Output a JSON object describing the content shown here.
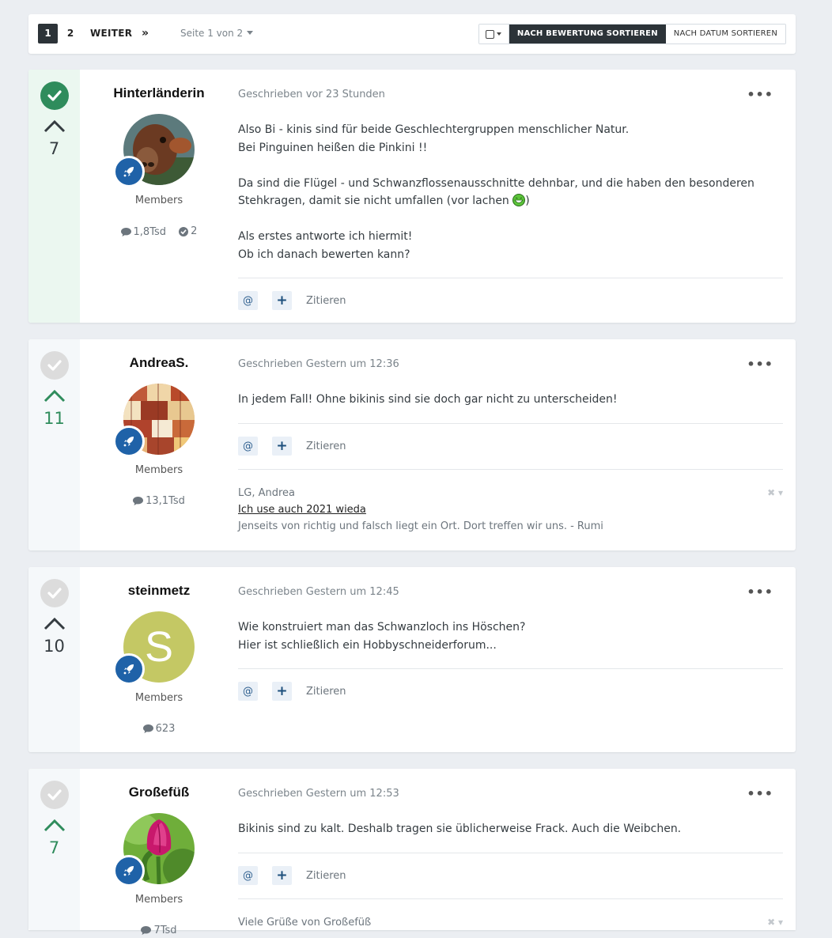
{
  "pagination": {
    "current": "1",
    "page2": "2",
    "next": "WEITER",
    "last_icon": "»",
    "info": "Seite 1 von 2"
  },
  "sort": {
    "by_rating": "NACH BEWERTUNG SORTIEREN",
    "by_date": "NACH DATUM SORTIEREN"
  },
  "colors": {
    "accent_green": "#2f8c5c",
    "rank_blue": "#1f62a8",
    "dark": "#2c3338"
  },
  "posts": [
    {
      "author": "Hinterländerin",
      "group": "Members",
      "posts_count": "1,8Tsd",
      "solutions_count": "2",
      "votes": "7",
      "solved": true,
      "meta": "Geschrieben vor 23 Stunden",
      "more": "•••",
      "lines": [
        "Also Bi - kinis sind für beide Geschlechtergruppen menschlicher Natur.",
        "Bei Pinguinen heißen die Pinkini !!",
        "",
        "Da sind die Flügel - und Schwanzflossenausschnitte dehnbar, und die haben den besonderen",
        "Stehkragen, damit sie nicht umfallen (vor lachen",
        "",
        "Als erstes antworte ich hiermit!",
        "Ob ich danach bewerten kann?"
      ],
      "line5_suffix": ")",
      "mention": "@",
      "plus": "+",
      "quote": "Zitieren"
    },
    {
      "author": "AndreaS.",
      "group": "Members",
      "posts_count": "13,1Tsd",
      "votes": "11",
      "meta": "Geschrieben Gestern um 12:36",
      "more": "•••",
      "lines": [
        "In jedem Fall! Ohne bikinis sind sie doch gar nicht zu unterscheiden!"
      ],
      "mention": "@",
      "plus": "+",
      "quote": "Zitieren",
      "signature": {
        "line1": "LG, Andrea",
        "link": "Ich use auch 2021 wieda",
        "line3": "Jenseits von richtig und falsch liegt ein Ort. Dort treffen wir uns. - Rumi"
      }
    },
    {
      "author": "steinmetz",
      "group": "Members",
      "posts_count": "623",
      "votes": "10",
      "avatar_letter": "S",
      "meta": "Geschrieben Gestern um 12:45",
      "more": "•••",
      "lines": [
        "Wie konstruiert man das Schwanzloch ins Höschen?",
        "Hier ist schließlich ein Hobbyschneiderforum..."
      ],
      "mention": "@",
      "plus": "+",
      "quote": "Zitieren"
    },
    {
      "author": "Großefüß",
      "group": "Members",
      "posts_count": "7Tsd",
      "votes": "7",
      "meta": "Geschrieben Gestern um 12:53",
      "more": "•••",
      "lines": [
        "Bikinis sind zu kalt. Deshalb tragen sie üblicherweise Frack. Auch die Weibchen."
      ],
      "mention": "@",
      "plus": "+",
      "quote": "Zitieren",
      "signature": {
        "line1": "Viele Grüße von Großefüß"
      }
    }
  ]
}
